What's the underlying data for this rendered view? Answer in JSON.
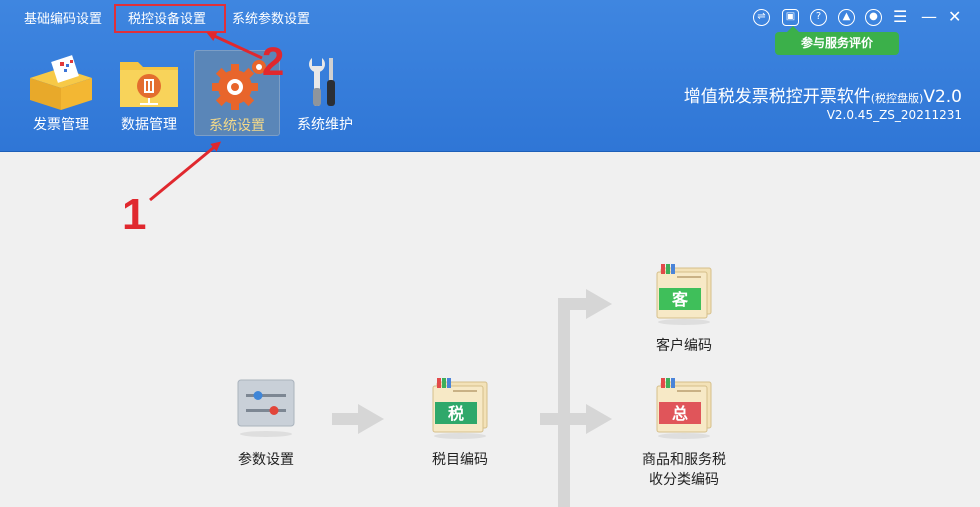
{
  "menu": {
    "items": [
      "基础编码设置",
      "税控设备设置",
      "系统参数设置"
    ]
  },
  "window_controls": {
    "icons": [
      "exchange-icon",
      "note-icon",
      "help-icon",
      "lock-icon",
      "user-icon",
      "menu-icon",
      "minimize-icon",
      "close-icon"
    ]
  },
  "eval_button": {
    "label": "参与服务评价"
  },
  "modules": [
    {
      "label": "发票管理",
      "icon": "invoice-box-icon"
    },
    {
      "label": "数据管理",
      "icon": "data-folder-icon"
    },
    {
      "label": "系统设置",
      "icon": "gear-icon"
    },
    {
      "label": "系统维护",
      "icon": "wrench-icon"
    }
  ],
  "app": {
    "title": "增值税发票税控开票软件",
    "edition": "(税控盘版)",
    "version_suffix": "V2.0",
    "build": "V2.0.45_ZS_20211231"
  },
  "annotations": {
    "step1": "1",
    "step2": "2"
  },
  "flow": {
    "param_settings": "参数设置",
    "tax_item_code": "税目编码",
    "customer_code": "客户编码",
    "goods_code_line1": "商品和服务税",
    "goods_code_line2": "收分类编码",
    "book_tax_char": "税",
    "book_customer_char": "客",
    "book_total_char": "总"
  },
  "colors": {
    "header_blue": "#2f76d6",
    "active_tile": "#5a86b8",
    "eval_green": "#3bb04a",
    "annotation_red": "#e0282e"
  }
}
